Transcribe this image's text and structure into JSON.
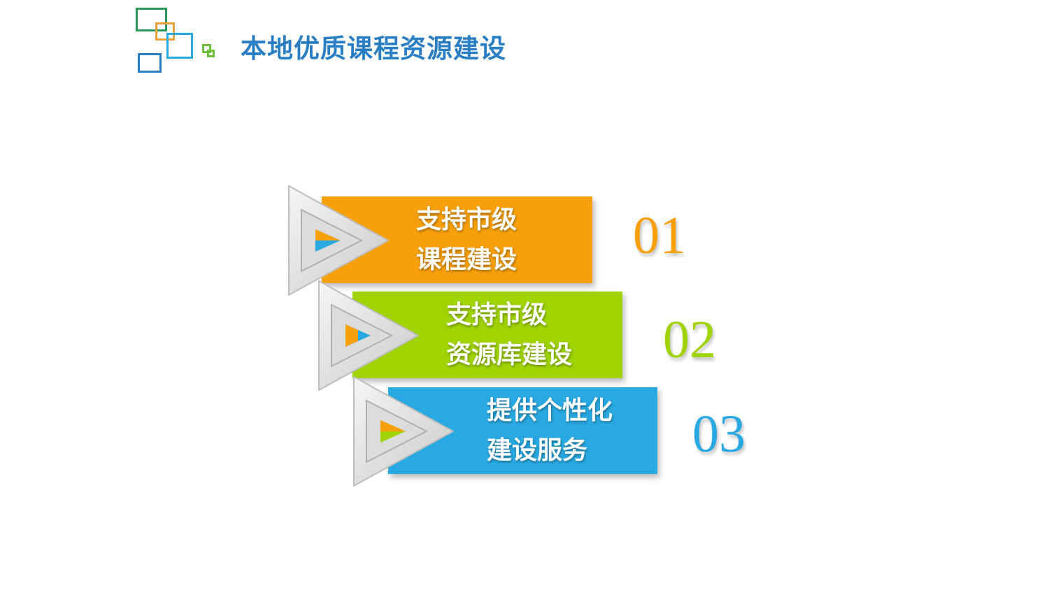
{
  "title": "本地优质课程资源建设",
  "logo": {
    "icon": "squares-logo-icon"
  },
  "colors": {
    "title": "#2a7fc4",
    "orange": "#f7a00a",
    "green": "#9fd301",
    "blue": "#28a9e1",
    "triangle_face": "#e8e8e8"
  },
  "steps": [
    {
      "number": "01",
      "line1": "支持市级",
      "line2": "课程建设",
      "color": "#f7a00a"
    },
    {
      "number": "02",
      "line1": "支持市级",
      "line2": "资源库建设",
      "color": "#9fd301"
    },
    {
      "number": "03",
      "line1": "提供个性化",
      "line2": "建设服务",
      "color": "#28a9e1"
    }
  ]
}
